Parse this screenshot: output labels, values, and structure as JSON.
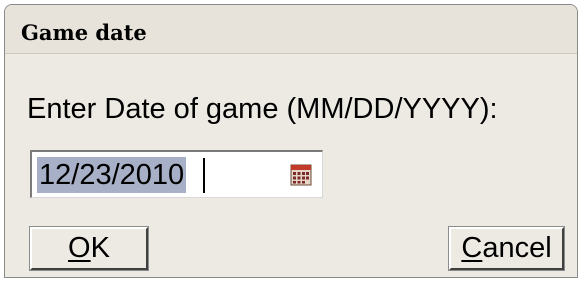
{
  "window": {
    "title": "Game date"
  },
  "prompt": {
    "label": "Enter Date of game (MM/DD/YYYY):"
  },
  "date_field": {
    "value": "12/23/2010",
    "text_selected": true,
    "calendar_icon": "calendar-icon"
  },
  "buttons": {
    "ok": {
      "mnemonic": "O",
      "rest": "K"
    },
    "cancel": {
      "mnemonic": "C",
      "rest": "ancel"
    }
  },
  "colors": {
    "dialog_background": "#ede9e3",
    "selection_highlight": "#a7b0c6",
    "calendar_icon_red": "#c23a2a"
  }
}
